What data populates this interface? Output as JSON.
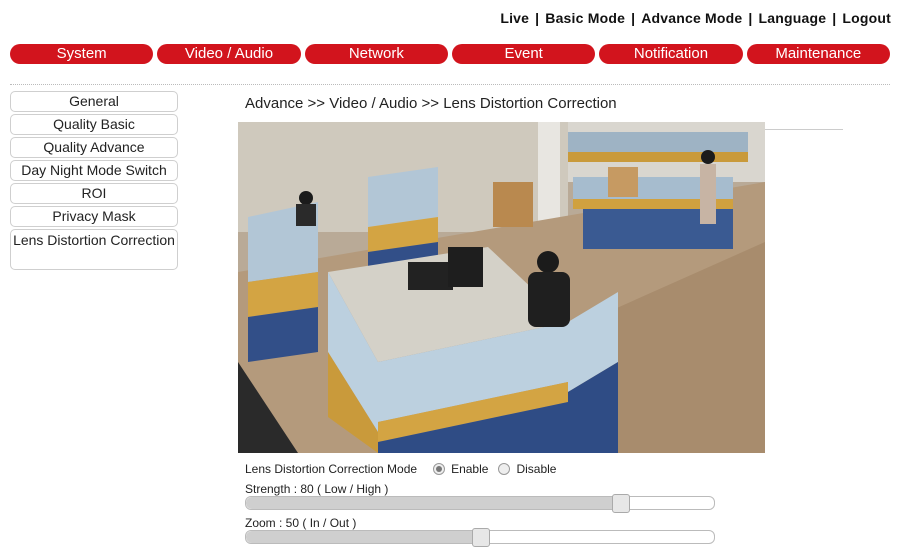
{
  "top_links": [
    "Live",
    "Basic Mode",
    "Advance Mode",
    "Language",
    "Logout"
  ],
  "top_separator": "|",
  "nav_tabs": [
    "System",
    "Video / Audio",
    "Network",
    "Event",
    "Notification",
    "Maintenance"
  ],
  "sidebar": [
    "General",
    "Quality Basic",
    "Quality Advance",
    "Day Night Mode Switch",
    "ROI",
    "Privacy Mask",
    "Lens Distortion Correction"
  ],
  "breadcrumb": "Advance >> Video / Audio >> Lens Distortion Correction",
  "ldc": {
    "mode_label": "Lens Distortion Correction Mode",
    "enable_label": "Enable",
    "disable_label": "Disable",
    "selected": "Enable",
    "strength_label": "Strength : 80 ( Low / High )",
    "strength_value": 80,
    "zoom_label": "Zoom : 50 ( In / Out )",
    "zoom_value": 50
  },
  "colors": {
    "nav_red": "#d2141d"
  }
}
